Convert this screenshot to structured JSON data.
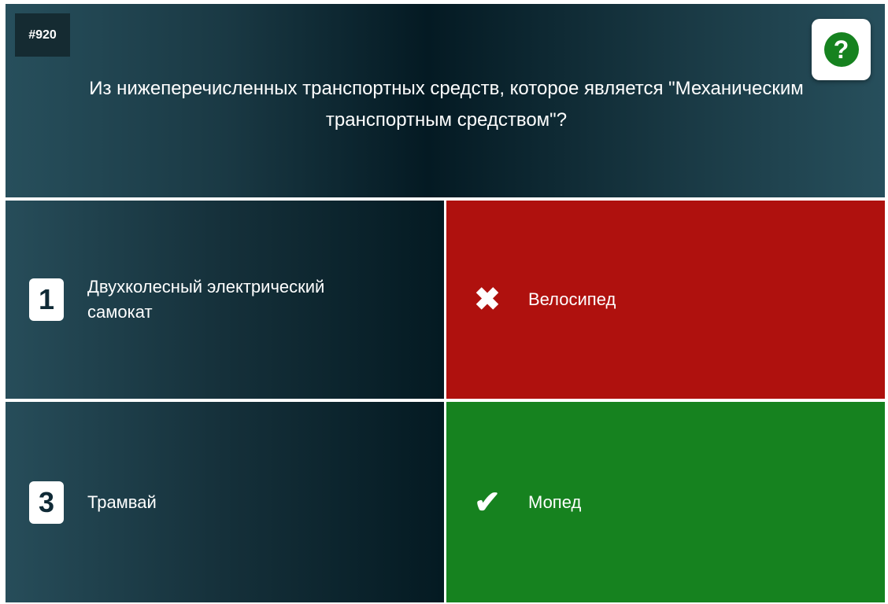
{
  "question": {
    "number": "#920",
    "text": "Из нижеперечисленных транспортных средств, которое является \"Механическим транспортным средством\"?"
  },
  "help": {
    "icon": "?"
  },
  "answers": [
    {
      "number": "1",
      "label": "Двухколесный электрический самокат",
      "state": "neutral"
    },
    {
      "icon": "✖",
      "label": "Велосипед",
      "state": "wrong",
      "color": "#af110e"
    },
    {
      "number": "3",
      "label": "Трамвай",
      "state": "neutral"
    },
    {
      "icon": "✔",
      "label": "Мопед",
      "state": "correct",
      "color": "#16821f"
    }
  ]
}
